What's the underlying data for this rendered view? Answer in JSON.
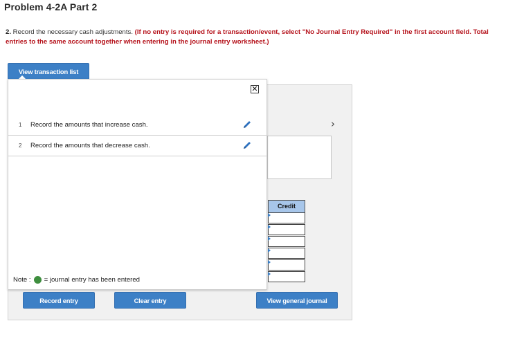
{
  "header": {
    "title": "Problem 4-2A Part 2"
  },
  "instructions": {
    "number": "2.",
    "plain": " Record the necessary cash adjustments. ",
    "red": "(If no entry is required for a transaction/event, select \"No Journal Entry Required\" in the first account field. Total entries to the same account together when entering in the journal entry worksheet.)"
  },
  "buttons": {
    "view_transaction_list": "View transaction list",
    "record_entry": "Record entry",
    "clear_entry": "Clear entry",
    "view_general_journal": "View general journal"
  },
  "popup": {
    "close_symbol": "✕",
    "transactions": [
      {
        "number": "1",
        "label": "Record the amounts that increase cash."
      },
      {
        "number": "2",
        "label": "Record the amounts that decrease cash."
      }
    ]
  },
  "worksheet": {
    "credit_header": "Credit",
    "next_symbol": "›"
  },
  "note": {
    "prefix": "Note :",
    "suffix": "= journal entry has been entered"
  },
  "colors": {
    "accent": "#3d80c6",
    "required_text": "#b5121b",
    "entered_dot": "#3e8e3e",
    "credit_header_bg": "#a7c6ea"
  }
}
